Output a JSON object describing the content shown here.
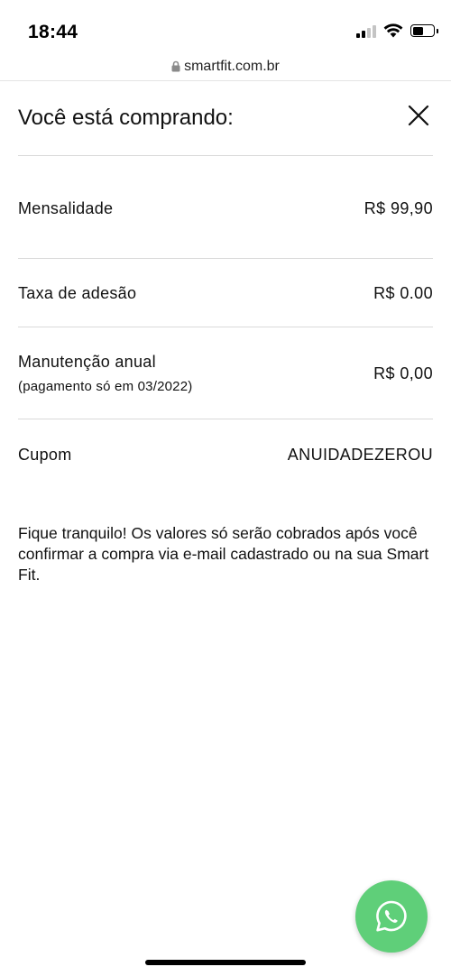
{
  "status_bar": {
    "time": "18:44",
    "icons": [
      "cellular-signal-icon",
      "wifi-icon",
      "battery-icon"
    ],
    "battery_level": 0.5
  },
  "browser": {
    "url": "smartfit.com.br",
    "lock_icon": "lock-icon"
  },
  "modal": {
    "title": "Você está comprando:",
    "close_icon": "close-icon",
    "items": [
      {
        "label": "Mensalidade",
        "value": "R$ 99,90"
      },
      {
        "label": "Taxa de adesão",
        "value": "R$ 0.00"
      },
      {
        "label": "Manutenção anual",
        "sublabel": "(pagamento só em 03/2022)",
        "value": "R$ 0,00"
      },
      {
        "label": "Cupom",
        "value": "ANUIDADEZEROU"
      }
    ],
    "notice": "Fique tranquilo! Os valores só serão cobrados após você confirmar a compra via e-mail cadastrado ou na sua Smart Fit."
  },
  "whatsapp": {
    "icon": "whatsapp-icon",
    "color": "#5fcf79"
  }
}
